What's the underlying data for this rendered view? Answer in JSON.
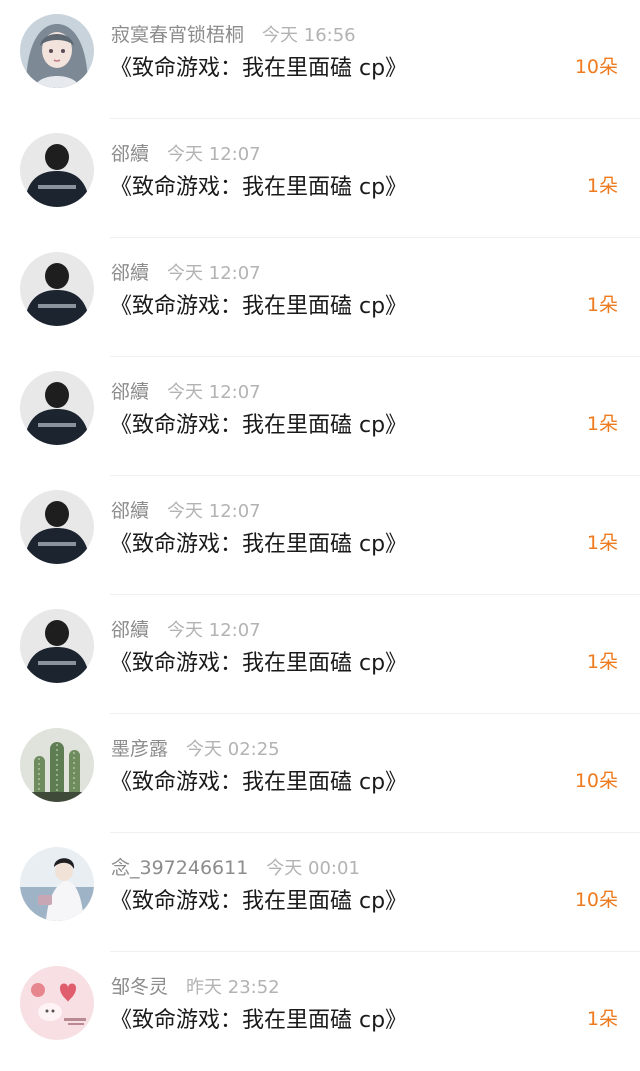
{
  "gift_list": {
    "items": [
      {
        "username": "寂寞春宵锁梧桐",
        "time": "今天 16:56",
        "title": "《致命游戏：我在里面磕 cp》",
        "count": "10朵",
        "avatar": "avatar-anime-girl"
      },
      {
        "username": "郤續",
        "time": "今天 12:07",
        "title": "《致命游戏：我在里面磕 cp》",
        "count": "1朵",
        "avatar": "avatar-dark-hoodie"
      },
      {
        "username": "郤續",
        "time": "今天 12:07",
        "title": "《致命游戏：我在里面磕 cp》",
        "count": "1朵",
        "avatar": "avatar-dark-hoodie"
      },
      {
        "username": "郤續",
        "time": "今天 12:07",
        "title": "《致命游戏：我在里面磕 cp》",
        "count": "1朵",
        "avatar": "avatar-dark-hoodie"
      },
      {
        "username": "郤續",
        "time": "今天 12:07",
        "title": "《致命游戏：我在里面磕 cp》",
        "count": "1朵",
        "avatar": "avatar-dark-hoodie"
      },
      {
        "username": "郤續",
        "time": "今天 12:07",
        "title": "《致命游戏：我在里面磕 cp》",
        "count": "1朵",
        "avatar": "avatar-dark-hoodie"
      },
      {
        "username": "墨彦露",
        "time": "今天 02:25",
        "title": "《致命游戏：我在里面磕 cp》",
        "count": "10朵",
        "avatar": "avatar-cactus"
      },
      {
        "username": "念_397246611",
        "time": "今天 00:01",
        "title": "《致命游戏：我在里面磕 cp》",
        "count": "10朵",
        "avatar": "avatar-hanfu-girl"
      },
      {
        "username": "邹冬灵",
        "time": "昨天 23:52",
        "title": "《致命游戏：我在里面磕 cp》",
        "count": "1朵",
        "avatar": "avatar-pink-cartoon"
      }
    ]
  },
  "colors": {
    "count_accent": "#ee7b1f",
    "username": "#8c8c8c",
    "time": "#b3b3b3",
    "title": "#1a1a1a"
  }
}
